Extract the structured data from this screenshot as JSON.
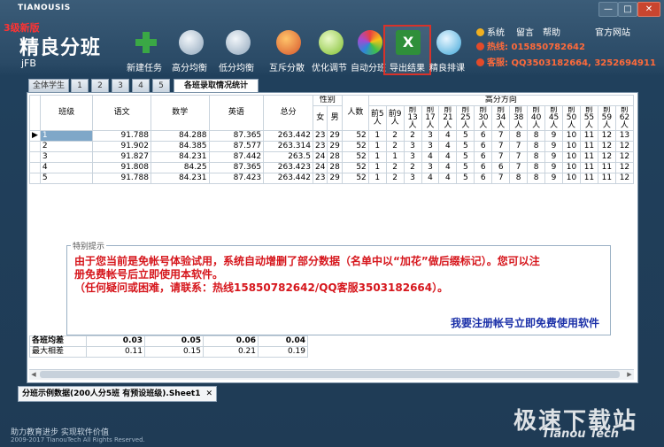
{
  "window": {
    "title": "TIANOUSIS",
    "controls": [
      "—",
      "□",
      "✕"
    ]
  },
  "brand": {
    "badge": "3级新版",
    "name": "精良分班",
    "sub": "jFB"
  },
  "toolbar": [
    {
      "label": "新建任务",
      "icon": "plus-icon",
      "color": "#39a845"
    },
    {
      "label": "高分均衡",
      "icon": "balance-high-icon",
      "color": "#8fa6bb"
    },
    {
      "label": "低分均衡",
      "icon": "balance-low-icon",
      "color": "#8fa6bb"
    },
    {
      "label": "互斥分散",
      "icon": "people-icon",
      "color": "#d6552b"
    },
    {
      "label": "优化调节",
      "icon": "adjust-icon",
      "color": "#7fbf2f"
    },
    {
      "label": "自动分班",
      "icon": "color-wheel-icon",
      "color": "#e64a8a"
    },
    {
      "label": "导出结果",
      "icon": "excel-icon",
      "color": "#2f8f3a"
    },
    {
      "label": "精良排课",
      "icon": "globe-icon",
      "color": "#3fa7d9"
    }
  ],
  "info": {
    "system": "系统",
    "message": "留言",
    "help": "帮助",
    "website": "官方网站",
    "hotline": "热线: 015850782642",
    "service": "客服: QQ3503182664, 3252694911"
  },
  "tabs": [
    "全体学生",
    "1",
    "2",
    "3",
    "4",
    "5",
    "各班录取情况统计"
  ],
  "active_tab_index": 6,
  "table": {
    "headers": {
      "class": "班级",
      "chinese": "语文",
      "math": "数学",
      "english": "英语",
      "total": "总分",
      "gender": "性别",
      "female": "女",
      "male": "男",
      "count": "人数",
      "high_group": "高分方向"
    },
    "top_n": [
      "前5人",
      "前9人",
      "前13人",
      "前17人",
      "前21人",
      "前25人",
      "前30人",
      "前34人",
      "前38人",
      "前40人",
      "前45人",
      "前50人",
      "前55人",
      "前59人",
      "前62人"
    ],
    "rows": [
      {
        "cls": "1",
        "chinese": "91.788",
        "math": "84.288",
        "english": "87.365",
        "total": "263.442",
        "female": "23",
        "male": "29",
        "count": "52",
        "top": [
          "1",
          "2",
          "2",
          "3",
          "4",
          "5",
          "6",
          "7",
          "8",
          "8",
          "9",
          "10",
          "11",
          "12",
          "13"
        ]
      },
      {
        "cls": "2",
        "chinese": "91.902",
        "math": "84.385",
        "english": "87.577",
        "total": "263.314",
        "female": "23",
        "male": "29",
        "count": "52",
        "top": [
          "1",
          "2",
          "3",
          "3",
          "4",
          "5",
          "6",
          "7",
          "7",
          "8",
          "9",
          "10",
          "11",
          "12",
          "12"
        ]
      },
      {
        "cls": "3",
        "chinese": "91.827",
        "math": "84.231",
        "english": "87.442",
        "total": "263.5",
        "female": "24",
        "male": "28",
        "count": "52",
        "top": [
          "1",
          "1",
          "3",
          "4",
          "4",
          "5",
          "6",
          "7",
          "7",
          "8",
          "9",
          "10",
          "11",
          "12",
          "12"
        ]
      },
      {
        "cls": "4",
        "chinese": "91.808",
        "math": "84.25",
        "english": "87.365",
        "total": "263.423",
        "female": "24",
        "male": "28",
        "count": "52",
        "top": [
          "1",
          "2",
          "2",
          "3",
          "4",
          "5",
          "6",
          "6",
          "7",
          "8",
          "9",
          "10",
          "11",
          "11",
          "12"
        ]
      },
      {
        "cls": "5",
        "chinese": "91.788",
        "math": "84.231",
        "english": "87.423",
        "total": "263.442",
        "female": "23",
        "male": "29",
        "count": "52",
        "top": [
          "1",
          "2",
          "3",
          "4",
          "4",
          "5",
          "6",
          "7",
          "8",
          "8",
          "9",
          "10",
          "11",
          "11",
          "12"
        ]
      }
    ]
  },
  "notice": {
    "legend": "特别提示",
    "line1": "由于您当前是免帐号体验试用，系统自动增删了部分数据（名单中以“加花”做后缀标记）。您可以注",
    "line2": "册免费帐号后立即使用本软件。",
    "line3": "（任何疑问或困难，请联系：热线15850782642/QQ客服3503182664）。",
    "register": "我要注册帐号立即免费使用软件"
  },
  "stats": {
    "avg_label": "各班均差",
    "avg": [
      "0.03",
      "0.05",
      "0.06",
      "0.04"
    ],
    "max_label": "最大相差",
    "max": [
      "0.11",
      "0.15",
      "0.21",
      "0.19"
    ]
  },
  "sheet_tab": "分班示例数据(200人分5班 有预设班级).Sheet1",
  "footer": {
    "slogan": "助力教育进步  实现软件价值",
    "copyright": "2009-2017 TianouTech All Rights Reserved."
  },
  "watermark": {
    "main": "极速下载站",
    "sub": "Tianou Tech"
  }
}
